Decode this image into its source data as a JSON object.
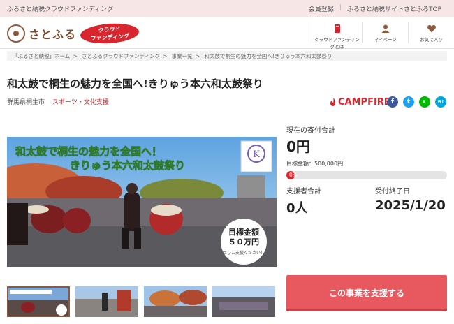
{
  "topbar": {
    "tagline": "ふるさと納税クラウドファンディング",
    "links": [
      "会員登録",
      "ふるさと納税サイトさとふるTOP"
    ]
  },
  "header": {
    "logo_text": "さとふる",
    "badge_line1": "クラウド",
    "badge_line2": "ファンディング",
    "nav": [
      {
        "label": "クラウドファンディングとは",
        "icon": "book-icon"
      },
      {
        "label": "マイページ",
        "icon": "person-icon"
      },
      {
        "label": "お気に入り",
        "icon": "heart-icon"
      }
    ]
  },
  "breadcrumb": [
    "「ふるさと納税」ホーム",
    "さとふるクラウドファンディング",
    "事業一覧",
    "和太鼓で桐生の魅力を全国へ!きりゅう本六和太鼓祭り"
  ],
  "project": {
    "title": "和太鼓で桐生の魅力を全国へ!きりゅう本六和太鼓祭り",
    "region": "群馬県桐生市",
    "category": "スポーツ・文化支援",
    "platform": "CAMPFIRE"
  },
  "share": [
    {
      "name": "facebook",
      "glyph": "f",
      "color": "#3b5998"
    },
    {
      "name": "twitter",
      "glyph": "t",
      "color": "#1da1f2"
    },
    {
      "name": "line",
      "glyph": "L",
      "color": "#00b900"
    },
    {
      "name": "hatena",
      "glyph": "B!",
      "color": "#00a4de"
    }
  ],
  "image": {
    "headline1": "和太鼓で桐生の魅力を全国へ！",
    "headline2": "きりゅう本六和太鼓祭り",
    "badge_label": "目標金額",
    "badge_amount": "５０万円",
    "badge_sub": "ぜひご支援ください！",
    "emblem_letter": "K"
  },
  "stats": {
    "current_label": "現在の寄付合計",
    "current_amount": "0円",
    "goal_text": "目標金額：500,000円",
    "progress_pct": 0,
    "progress_label": "0%",
    "supporters_label": "支援者合計",
    "supporters_value": "0人",
    "deadline_label": "受付終了日",
    "deadline_value": "2025/1/20"
  },
  "cta_label": "この事業を支援する",
  "colors": {
    "accent": "#d9262e",
    "brand_brown": "#7a4a2e",
    "cta": "#e8595f",
    "topbar_bg": "#f6e7e6"
  }
}
